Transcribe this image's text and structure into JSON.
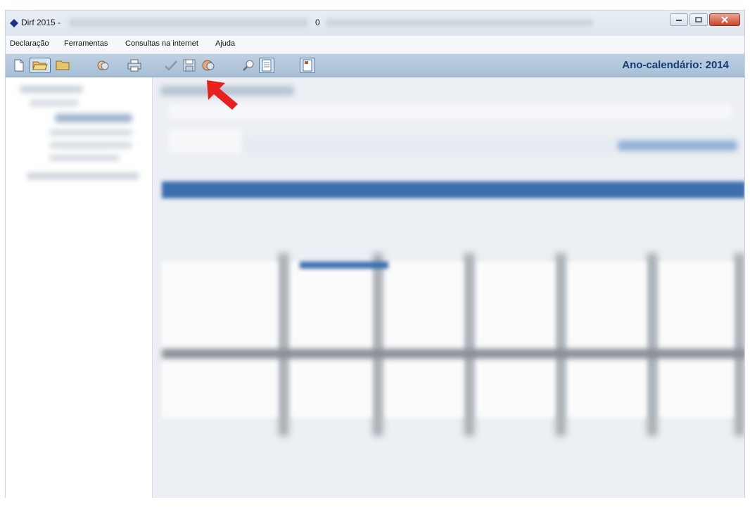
{
  "window": {
    "title": "Dirf 2015 -",
    "title_suffix": "0",
    "logo_icon": "blue-diamond-icon"
  },
  "menu": {
    "items": [
      "Declaração",
      "Ferramentas",
      "Consultas na internet",
      "Ajuda"
    ]
  },
  "toolbar": {
    "buttons": [
      {
        "icon": "new-file-icon"
      },
      {
        "icon": "open-folder-icon",
        "active": true
      },
      {
        "icon": "folder-icon"
      },
      {
        "icon": "copy-icon"
      },
      {
        "icon": "print-icon"
      },
      {
        "icon": "check-icon"
      },
      {
        "icon": "save-icon"
      },
      {
        "icon": "transmit-icon"
      },
      {
        "icon": "search-icon"
      },
      {
        "icon": "document-icon"
      },
      {
        "icon": "receipt-icon",
        "active": true
      }
    ],
    "ano_calendario": "Ano-calendário: 2014"
  },
  "colors": {
    "toolbar_bg": "#a7bfd6",
    "ano_text": "#163d73",
    "arrow": "#e8201e",
    "table_header": "#3c6fb0"
  }
}
